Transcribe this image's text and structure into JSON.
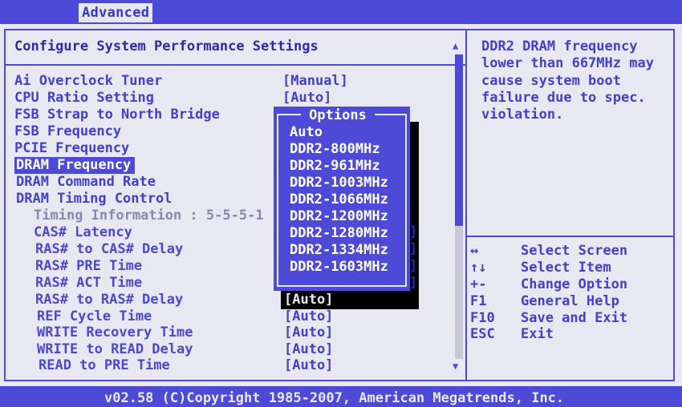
{
  "header": {
    "active_tab": "Advanced"
  },
  "section": {
    "title": "Configure System Performance Settings"
  },
  "settings": [
    {
      "label": "Ai Overclock Tuner",
      "value": "[Manual]"
    },
    {
      "label": "CPU Ratio Setting",
      "value": "[Auto]"
    },
    {
      "label": "FSB Strap to North Bridge",
      "value": ""
    },
    {
      "label": "FSB Frequency",
      "value": ""
    },
    {
      "label": "PCIE Frequency",
      "value": ""
    },
    {
      "label": "DRAM Frequency",
      "value": ""
    },
    {
      "label": "DRAM Command Rate",
      "value": ""
    },
    {
      "label": "DRAM Timing Control",
      "value": ""
    },
    {
      "label": "Timing Information : 5-5-5-1",
      "value": ""
    },
    {
      "label": "CAS# Latency",
      "value": ""
    },
    {
      "label": "RAS# to CAS# Delay",
      "value": ""
    },
    {
      "label": "RAS# PRE Time",
      "value": ""
    },
    {
      "label": "RAS# ACT Time",
      "value": ""
    },
    {
      "label": "RAS# to RAS# Delay",
      "value": "[Auto]"
    },
    {
      "label": "REF Cycle Time",
      "value": "[Auto]"
    },
    {
      "label": "WRITE Recovery Time",
      "value": "[Auto]"
    },
    {
      "label": "WRITE to READ Delay",
      "value": "[Auto]"
    },
    {
      "label": "READ to PRE Time",
      "value": "[Auto]"
    }
  ],
  "options_popup": {
    "title": "Options",
    "selected": "Auto",
    "items": [
      "Auto",
      "DDR2-800MHz",
      "DDR2-961MHz",
      "DDR2-1003MHz",
      "DDR2-1066MHz",
      "DDR2-1200MHz",
      "DDR2-1280MHz",
      "DDR2-1334MHz",
      "DDR2-1603MHz"
    ]
  },
  "help": {
    "lines": [
      "DDR2 DRAM frequency",
      "lower than 667MHz may",
      "cause system boot",
      "failure due to spec.",
      "violation."
    ],
    "keys": [
      {
        "key": "↔",
        "desc": "Select Screen"
      },
      {
        "key": "↑↓",
        "desc": "Select Item"
      },
      {
        "key": "+-",
        "desc": "Change Option"
      },
      {
        "key": "F1",
        "desc": "General Help"
      },
      {
        "key": "F10",
        "desc": "Save and Exit"
      },
      {
        "key": "ESC",
        "desc": "Exit"
      }
    ]
  },
  "footer": {
    "text": "v02.58 (C)Copyright 1985-2007, American Megatrends, Inc."
  },
  "colors": {
    "bios_blue": "#4c4ad6",
    "panel_bg": "#e8e8f2",
    "text_blue": "#4440cc",
    "highlight_text": "#ffffff"
  }
}
